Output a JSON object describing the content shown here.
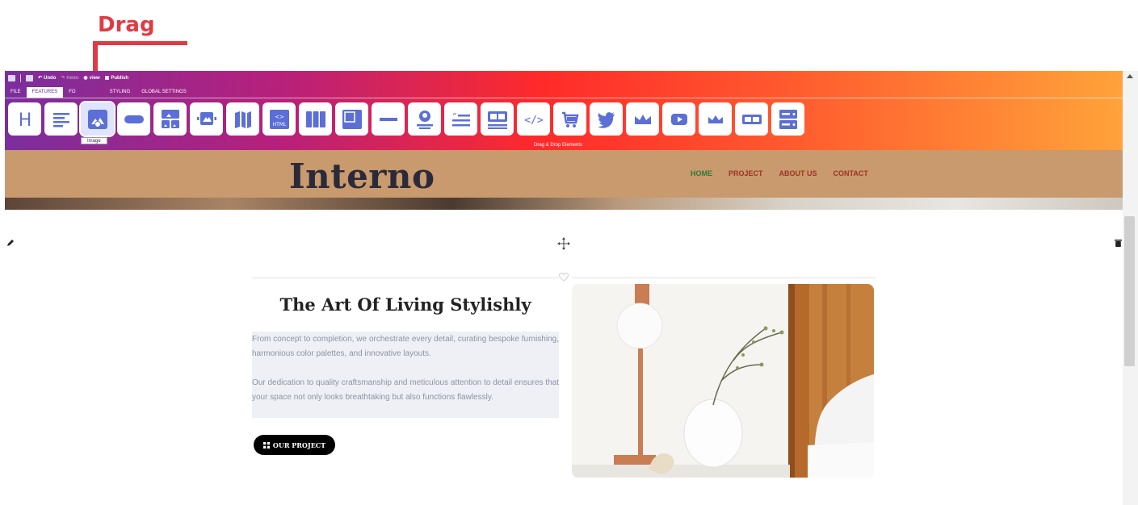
{
  "annotation": {
    "drag_label": "Drag",
    "color": "#e03a45"
  },
  "editor": {
    "quickbar": {
      "undo": "Undo",
      "redo": "Redo",
      "preview": "view",
      "publish": "Publish"
    },
    "tabs": [
      "FILE",
      "FEATURES",
      "FO",
      "STYLING",
      "GLOBAL SETTINGS"
    ],
    "active_tab": "FEATURES",
    "tools": [
      {
        "name": "heading",
        "icon": "heading-icon"
      },
      {
        "name": "text",
        "icon": "text-align-icon"
      },
      {
        "name": "image",
        "icon": "image-icon",
        "active": true
      },
      {
        "name": "button",
        "icon": "button-icon"
      },
      {
        "name": "gallery",
        "icon": "gallery-icon"
      },
      {
        "name": "slider",
        "icon": "slider-icon"
      },
      {
        "name": "map",
        "icon": "map-icon"
      },
      {
        "name": "html",
        "icon": "html-icon"
      },
      {
        "name": "columns",
        "icon": "columns-icon"
      },
      {
        "name": "box",
        "icon": "box-icon"
      },
      {
        "name": "divider",
        "icon": "divider-icon"
      },
      {
        "name": "testimonial",
        "icon": "testimonial-icon"
      },
      {
        "name": "quote",
        "icon": "quote-icon"
      },
      {
        "name": "cards",
        "icon": "cards-icon"
      },
      {
        "name": "code",
        "icon": "code-icon"
      },
      {
        "name": "cart",
        "icon": "cart-icon"
      },
      {
        "name": "twitter",
        "icon": "twitter-icon"
      },
      {
        "name": "crown",
        "icon": "crown-icon"
      },
      {
        "name": "youtube",
        "icon": "youtube-icon"
      },
      {
        "name": "crown-2",
        "icon": "crown-icon"
      },
      {
        "name": "toggle",
        "icon": "toggle-icon"
      },
      {
        "name": "form",
        "icon": "form-icon"
      }
    ],
    "tooltip": "Image",
    "caption": "Drag & Drop Elements"
  },
  "site": {
    "logo": "Interno",
    "nav": [
      {
        "label": "HOME",
        "active": true
      },
      {
        "label": "PROJECT"
      },
      {
        "label": "ABOUT US"
      },
      {
        "label": "CONTACT"
      }
    ],
    "header_color": "#c89a6d"
  },
  "section": {
    "heading": "The Art Of Living Stylishly",
    "paragraph1": "From concept to completion, we orchestrate every detail, curating bespoke furnishing, harmonious color palettes, and innovative layouts.",
    "paragraph2": "Our dedication to quality craftsmanship and meticulous attention to detail ensures that your space not only looks breathtaking but also functions flawlessly.",
    "button_label": "OUR PROJECT"
  }
}
